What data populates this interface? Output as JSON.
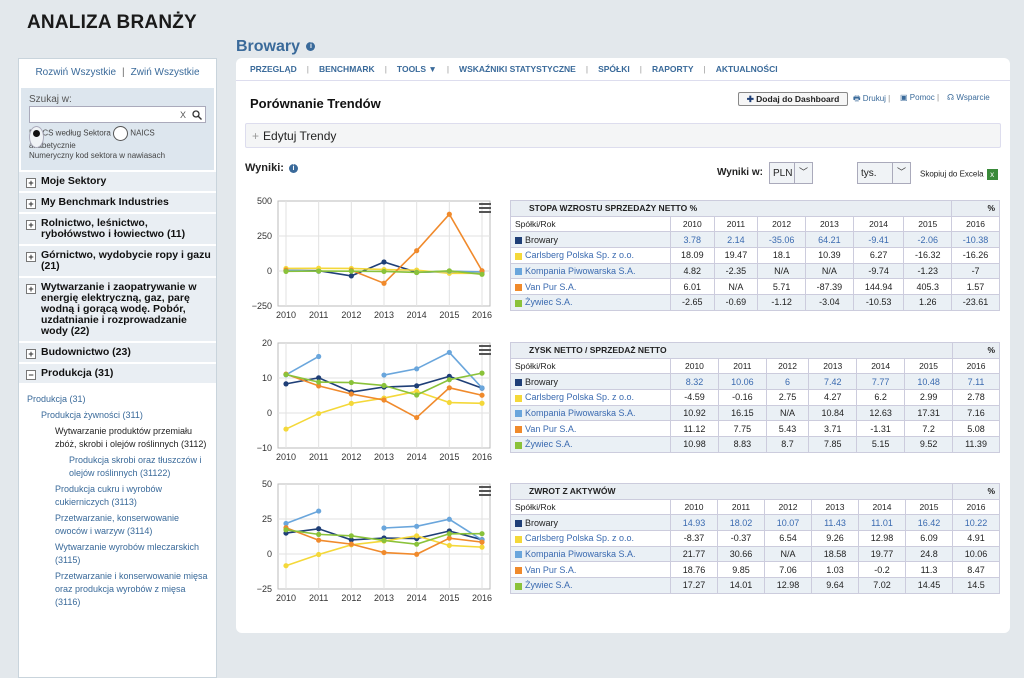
{
  "page_title": "ANALIZA BRANŻY",
  "section_title": "Browary",
  "sidebar": {
    "expand_all": "Rozwiń Wszystkie",
    "collapse_all": "Zwiń Wszystkie",
    "search_label": "Szukaj w:",
    "search_clear": "X",
    "radio1": "NAICS według Sektora",
    "radio2": "NAICS",
    "radio2b": "alfabetycznie",
    "radio_note": "Numeryczny kod sektora w nawiasach",
    "categories": [
      "Moje Sektory",
      "My Benchmark Industries",
      "Rolnictwo, leśnictwo, rybołówstwo i łowiectwo (11)",
      "Górnictwo, wydobycie ropy i gazu (21)",
      "Wytwarzanie i zaopatrywanie w energię elektryczną, gaz, parę wodną i gorącą wodę. Pobór, uzdatnianie i rozprowadzanie wody (22)",
      "Budownictwo (23)",
      "Produkcja (31)"
    ],
    "tree": [
      "Produkcja (31)",
      "Produkcja żywności (311)",
      "Wytwarzanie produktów przemiału zbóż, skrobi i olejów roślinnych (3112)",
      "Produkcja skrobi oraz tłuszczów i olejów roślinnych (31122)",
      "Produkcja cukru i wyrobów cukierniczych (3113)",
      "Przetwarzanie, konserwowanie owoców i warzyw (3114)",
      "Wytwarzanie wyrobów mleczarskich (3115)",
      "Przetwarzanie i konserwowanie mięsa oraz produkcja wyrobów z mięsa (3116)"
    ]
  },
  "nav": [
    "PRZEGLĄD",
    "BENCHMARK",
    "TOOLS ▼",
    "WSKAŹNIKI STATYSTYCZNE",
    "SPÓŁKI",
    "RAPORTY",
    "AKTUALNOŚCI"
  ],
  "main": {
    "heading": "Porównanie Trendów",
    "dashboard_btn": "Dodaj do Dashboard",
    "print": "Drukuj",
    "help": "Pomoc",
    "support": "Wsparcie",
    "edit_trends": "Edytuj Trendy",
    "results": "Wyniki:",
    "results_in": "Wyniki w:",
    "currency": "PLN",
    "units": "tys.",
    "copy_excel": "Skopiuj do Excela"
  },
  "colors": {
    "Browary": "#1f3f77",
    "Carlsberg": "#f4d83a",
    "Kompania": "#6aa6dc",
    "VanPur": "#f08a2c",
    "Zywiec": "#8ac23a"
  },
  "companies": [
    "Browary",
    "Carlsberg Polska Sp. z o.o.",
    "Kompania Piwowarska S.A.",
    "Van Pur S.A.",
    "Żywiec S.A."
  ],
  "years": [
    "2010",
    "2011",
    "2012",
    "2013",
    "2014",
    "2015",
    "2016"
  ],
  "col_label": "Spółki/Rok",
  "pct": "%",
  "tables": [
    {
      "title": "STOPA WZROSTU SPRZEDAŻY NETTO %",
      "rows": [
        [
          "3.78",
          "2.14",
          "-35.06",
          "64.21",
          "-9.41",
          "-2.06",
          "-10.38"
        ],
        [
          "18.09",
          "19.47",
          "18.1",
          "10.39",
          "6.27",
          "-16.32",
          "-16.26"
        ],
        [
          "4.82",
          "-2.35",
          "N/A",
          "N/A",
          "-9.74",
          "-1.23",
          "-7"
        ],
        [
          "6.01",
          "N/A",
          "5.71",
          "-87.39",
          "144.94",
          "405.3",
          "1.57"
        ],
        [
          "-2.65",
          "-0.69",
          "-1.12",
          "-3.04",
          "-10.53",
          "1.26",
          "-23.61"
        ]
      ]
    },
    {
      "title": "ZYSK NETTO / SPRZEDAŻ NETTO",
      "rows": [
        [
          "8.32",
          "10.06",
          "6",
          "7.42",
          "7.77",
          "10.48",
          "7.11"
        ],
        [
          "-4.59",
          "-0.16",
          "2.75",
          "4.27",
          "6.2",
          "2.99",
          "2.78"
        ],
        [
          "10.92",
          "16.15",
          "N/A",
          "10.84",
          "12.63",
          "17.31",
          "7.16"
        ],
        [
          "11.12",
          "7.75",
          "5.43",
          "3.71",
          "-1.31",
          "7.2",
          "5.08"
        ],
        [
          "10.98",
          "8.83",
          "8.7",
          "7.85",
          "5.15",
          "9.52",
          "11.39"
        ]
      ]
    },
    {
      "title": "ZWROT Z AKTYWÓW",
      "rows": [
        [
          "14.93",
          "18.02",
          "10.07",
          "11.43",
          "11.01",
          "16.42",
          "10.22"
        ],
        [
          "-8.37",
          "-0.37",
          "6.54",
          "9.26",
          "12.98",
          "6.09",
          "4.91"
        ],
        [
          "21.77",
          "30.66",
          "N/A",
          "18.58",
          "19.77",
          "24.8",
          "10.06"
        ],
        [
          "18.76",
          "9.85",
          "7.06",
          "1.03",
          "-0.2",
          "11.3",
          "8.47"
        ],
        [
          "17.27",
          "14.01",
          "12.98",
          "9.64",
          "7.02",
          "14.45",
          "14.5"
        ]
      ]
    }
  ],
  "chart_data": [
    {
      "type": "line",
      "x": [
        2010,
        2011,
        2012,
        2013,
        2014,
        2015,
        2016
      ],
      "ylim": [
        -250,
        500
      ],
      "yticks": [
        "500",
        "250",
        "0",
        "−250"
      ],
      "series": [
        {
          "name": "Browary",
          "values": [
            3.78,
            2.14,
            -35.06,
            64.21,
            -9.41,
            -2.06,
            -10.38
          ]
        },
        {
          "name": "Carlsberg Polska Sp. z o.o.",
          "values": [
            18.09,
            19.47,
            18.1,
            10.39,
            6.27,
            -16.32,
            -16.26
          ]
        },
        {
          "name": "Kompania Piwowarska S.A.",
          "values": [
            4.82,
            -2.35,
            null,
            null,
            -9.74,
            -1.23,
            -7
          ]
        },
        {
          "name": "Van Pur S.A.",
          "values": [
            6.01,
            null,
            5.71,
            -87.39,
            144.94,
            405.3,
            1.57
          ]
        },
        {
          "name": "Żywiec S.A.",
          "values": [
            -2.65,
            -0.69,
            -1.12,
            -3.04,
            -10.53,
            1.26,
            -23.61
          ]
        }
      ]
    },
    {
      "type": "line",
      "x": [
        2010,
        2011,
        2012,
        2013,
        2014,
        2015,
        2016
      ],
      "ylim": [
        -10,
        20
      ],
      "yticks": [
        "20",
        "10",
        "0",
        "−10"
      ],
      "series": [
        {
          "name": "Browary",
          "values": [
            8.32,
            10.06,
            6,
            7.42,
            7.77,
            10.48,
            7.11
          ]
        },
        {
          "name": "Carlsberg Polska Sp. z o.o.",
          "values": [
            -4.59,
            -0.16,
            2.75,
            4.27,
            6.2,
            2.99,
            2.78
          ]
        },
        {
          "name": "Kompania Piwowarska S.A.",
          "values": [
            10.92,
            16.15,
            null,
            10.84,
            12.63,
            17.31,
            7.16
          ]
        },
        {
          "name": "Van Pur S.A.",
          "values": [
            11.12,
            7.75,
            5.43,
            3.71,
            -1.31,
            7.2,
            5.08
          ]
        },
        {
          "name": "Żywiec S.A.",
          "values": [
            10.98,
            8.83,
            8.7,
            7.85,
            5.15,
            9.52,
            11.39
          ]
        }
      ]
    },
    {
      "type": "line",
      "x": [
        2010,
        2011,
        2012,
        2013,
        2014,
        2015,
        2016
      ],
      "ylim": [
        -25,
        50
      ],
      "yticks": [
        "50",
        "25",
        "0",
        "−25"
      ],
      "series": [
        {
          "name": "Browary",
          "values": [
            14.93,
            18.02,
            10.07,
            11.43,
            11.01,
            16.42,
            10.22
          ]
        },
        {
          "name": "Carlsberg Polska Sp. z o.o.",
          "values": [
            -8.37,
            -0.37,
            6.54,
            9.26,
            12.98,
            6.09,
            4.91
          ]
        },
        {
          "name": "Kompania Piwowarska S.A.",
          "values": [
            21.77,
            30.66,
            null,
            18.58,
            19.77,
            24.8,
            10.06
          ]
        },
        {
          "name": "Van Pur S.A.",
          "values": [
            18.76,
            9.85,
            7.06,
            1.03,
            -0.2,
            11.3,
            8.47
          ]
        },
        {
          "name": "Żywiec S.A.",
          "values": [
            17.27,
            14.01,
            12.98,
            9.64,
            7.02,
            14.45,
            14.5
          ]
        }
      ]
    }
  ]
}
